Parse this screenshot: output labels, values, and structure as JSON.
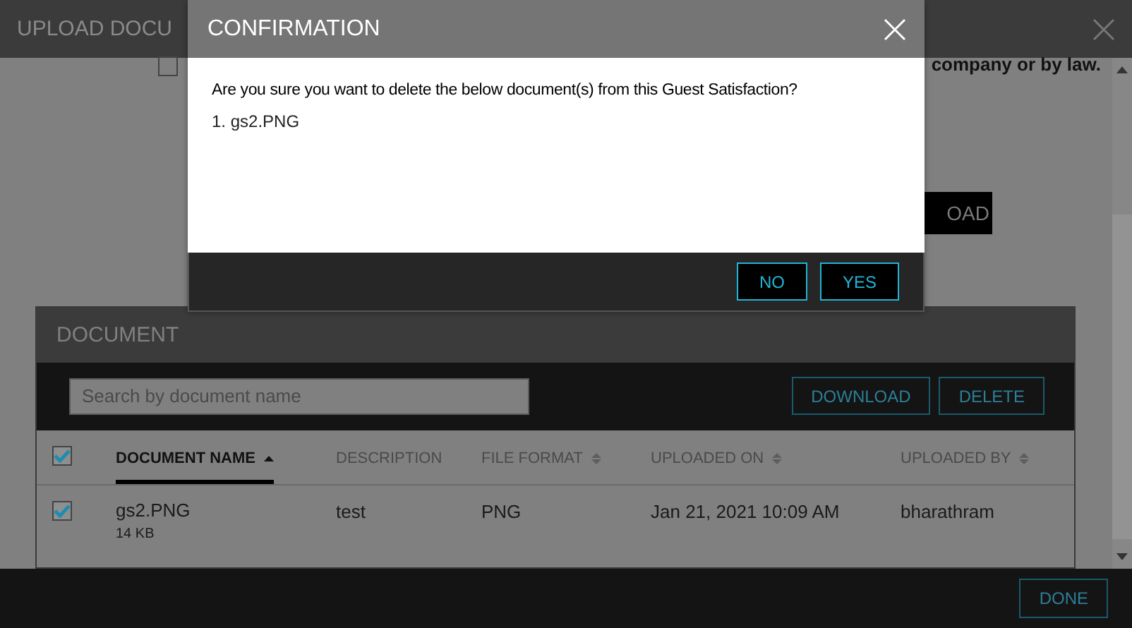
{
  "page": {
    "title": "UPLOAD DOCU",
    "consent": {
      "checked": false,
      "text": "company or by law."
    },
    "upload_button": "OAD",
    "documents": {
      "title": "DOCUMENT",
      "search": {
        "placeholder": "Search by document name"
      },
      "buttons": [
        "DOWNLOAD",
        "DELETE"
      ],
      "select_all": {
        "checked": true
      },
      "columns": [
        {
          "label": "DOCUMENT NAME",
          "kind": "sorted",
          "selected": true
        },
        {
          "label": "DESCRIPTION",
          "kind": "plain",
          "selected": false
        },
        {
          "label": "FILE FORMAT",
          "kind": "sortable",
          "selected": false
        },
        {
          "label": "UPLOADED ON",
          "kind": "sortable",
          "selected": false
        },
        {
          "label": "UPLOADED BY",
          "kind": "sortable",
          "selected": false
        }
      ],
      "rows": [
        {
          "checked": true,
          "name": "gs2.PNG",
          "size": "14 KB",
          "description": "test",
          "format": "PNG",
          "uploaded_on": "Jan 21, 2021 10:09 AM",
          "uploaded_by": "bharathram"
        }
      ]
    },
    "done_button": "DONE"
  },
  "dialog": {
    "title": "CONFIRMATION",
    "message": "Are you sure you want to delete the below document(s) from this Guest Satisfaction?",
    "items": [
      "1. gs2.PNG"
    ],
    "buttons": [
      "NO",
      "YES"
    ]
  }
}
